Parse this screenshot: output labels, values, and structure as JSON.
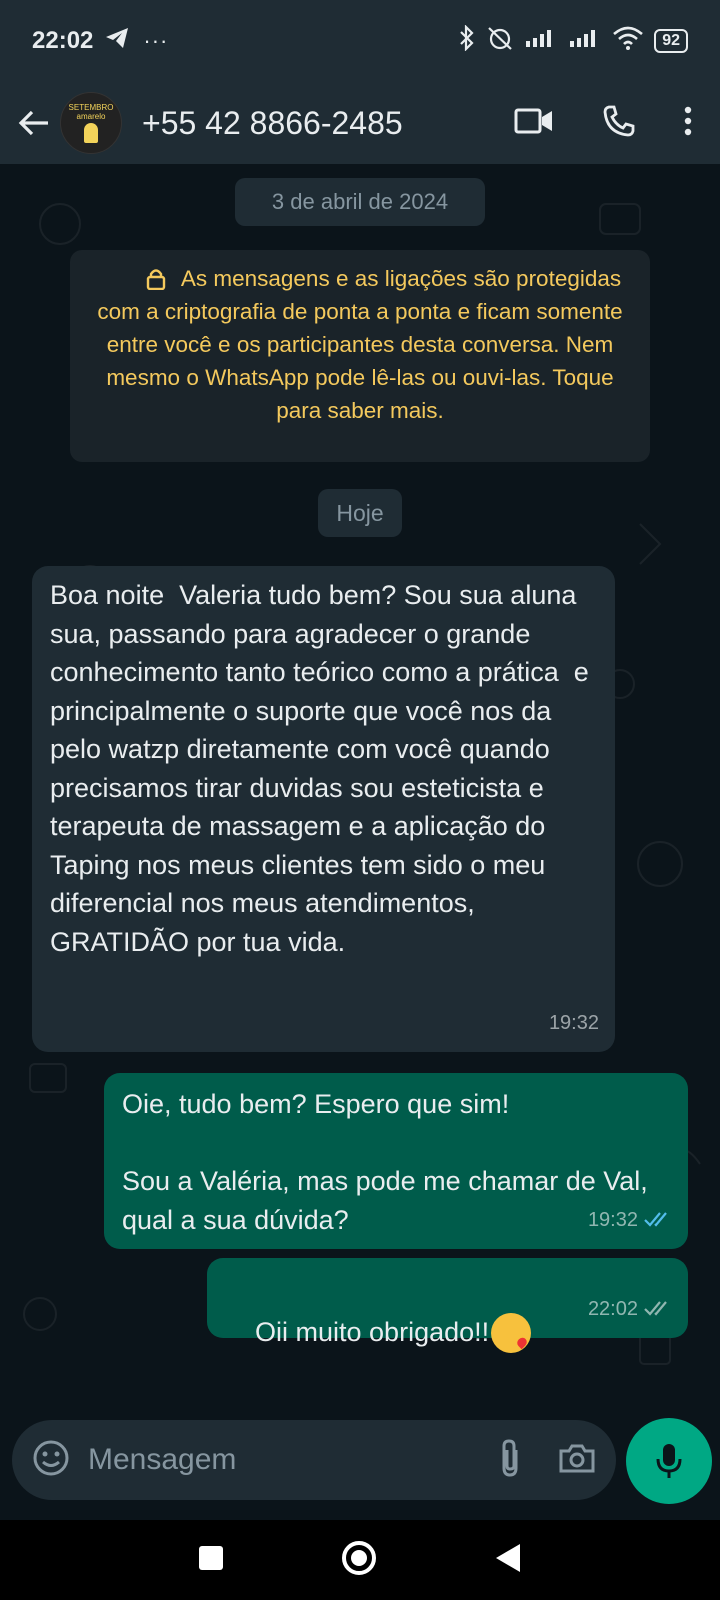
{
  "statusbar": {
    "time": "22:02",
    "dots": "···",
    "battery": "92"
  },
  "header": {
    "contact": "+55 42 8866-2485",
    "avatar_text": "SETEMBRO amarelo"
  },
  "chat": {
    "date_chip": "3 de abril de 2024",
    "notice": "As mensagens e as ligações são protegidas com a criptografia de ponta a ponta e ficam somente entre você e os participantes desta conversa. Nem mesmo o WhatsApp pode lê-las ou ouvi-las. Toque para saber mais.",
    "today_chip": "Hoje",
    "messages": [
      {
        "direction": "in",
        "text": "Boa noite  Valeria tudo bem? Sou sua aluna sua, passando para agradecer o grande conhecimento tanto teórico como a prática  e principalmente o suporte que você nos da pelo watzp diretamente com você quando precisamos tirar duvidas sou esteticista e terapeuta de massagem e a aplicação do Taping nos meus clientes tem sido o meu diferencial nos meus atendimentos, GRATIDÃO por tua vida.",
        "time": "19:32"
      },
      {
        "direction": "out",
        "text": "Oie, tudo bem? Espero que sim!\n\nSou a Valéria, mas pode me chamar de Val, qual a sua dúvida?",
        "time": "19:32",
        "status": "read"
      },
      {
        "direction": "out",
        "text": "Oii muito obrigado!!",
        "emoji": "face-blowing-a-kiss",
        "time": "22:02",
        "status": "delivered"
      }
    ]
  },
  "input": {
    "placeholder": "Mensagem"
  },
  "colors": {
    "header": "#1f2c34",
    "bg": "#0b141a",
    "in_bubble": "#1f2c34",
    "out_bubble": "#005c4b",
    "accent": "#00a884",
    "notice_text": "#f4c95d",
    "read_tick": "#53bdeb"
  }
}
